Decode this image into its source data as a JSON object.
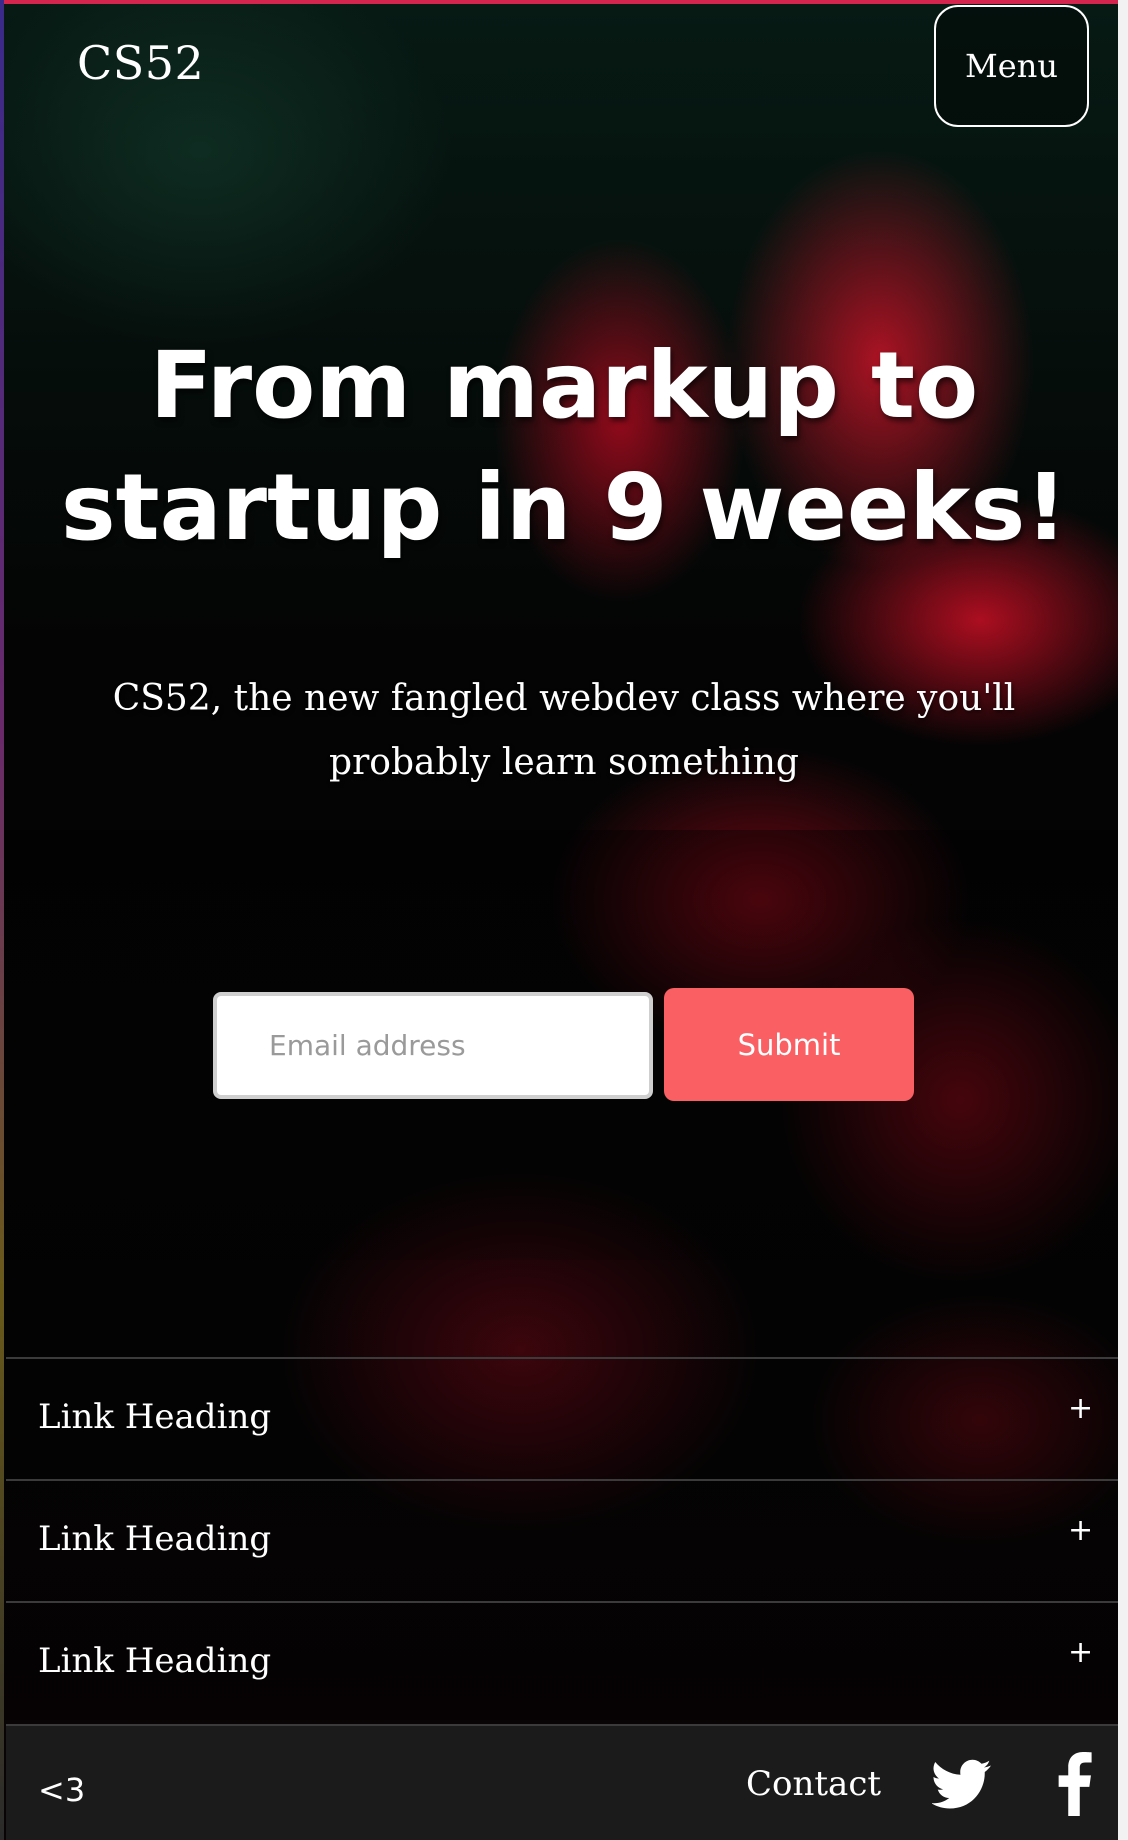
{
  "header": {
    "brand": "CS52",
    "menu_label": "Menu"
  },
  "hero": {
    "title": "From markup to startup in 9 weeks!",
    "subtitle": "CS52, the new fangled webdev class where you'll probably learn something"
  },
  "signup": {
    "email_placeholder": "Email address",
    "email_value": "",
    "submit_label": "Submit"
  },
  "links": [
    {
      "label": "Link Heading",
      "toggle": "+"
    },
    {
      "label": "Link Heading",
      "toggle": "+"
    },
    {
      "label": "Link Heading",
      "toggle": "+"
    }
  ],
  "footer": {
    "tagline": "<3",
    "contact_label": "Contact",
    "social": [
      "twitter-icon",
      "facebook-icon"
    ]
  },
  "colors": {
    "accent": "#fa6063",
    "top_bar": "#d4254e",
    "footer_bg": "#1b1b1b"
  }
}
